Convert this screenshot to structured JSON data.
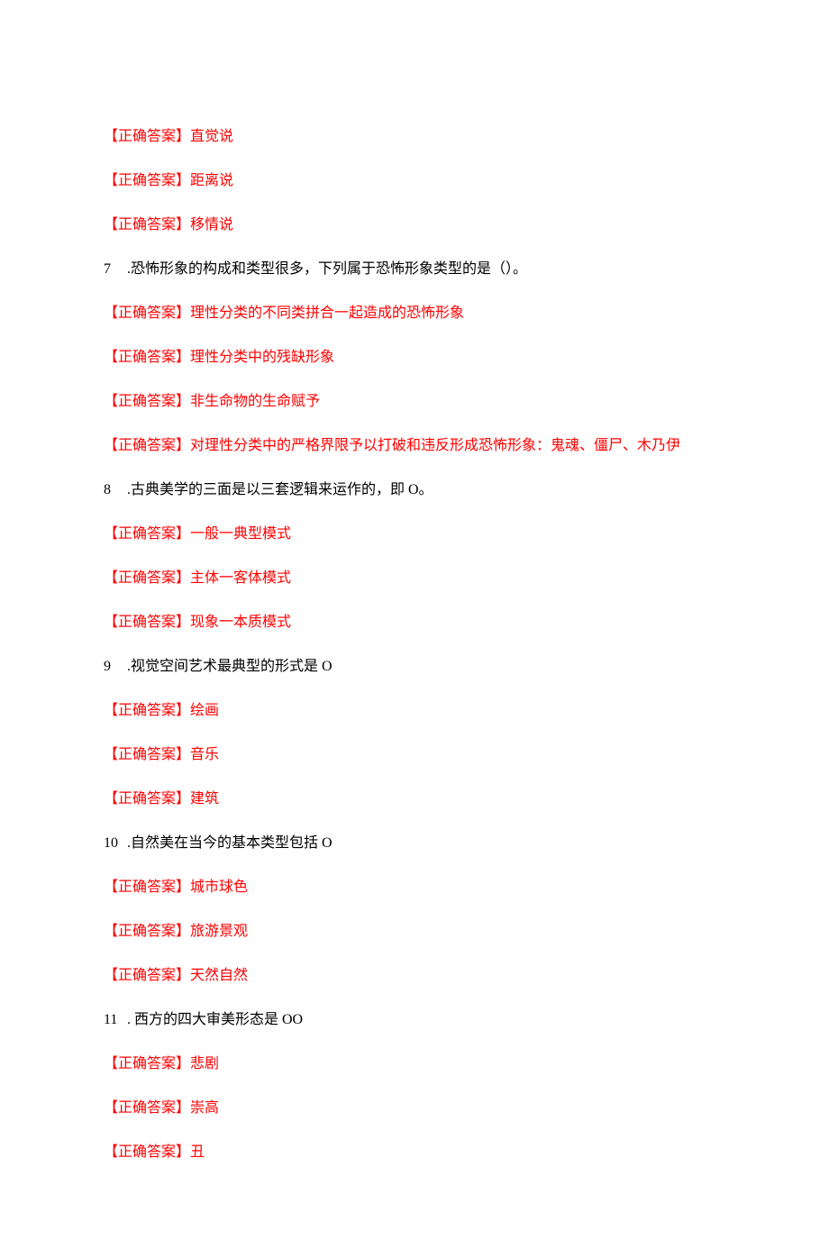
{
  "answerLabel": "【正确答案】",
  "lines": [
    {
      "type": "answer",
      "text": "直觉说"
    },
    {
      "type": "answer",
      "text": "距离说"
    },
    {
      "type": "answer",
      "text": "移情说"
    },
    {
      "type": "question",
      "num": "7",
      "text": ".恐怖形象的构成和类型很多，下列属于恐怖形象类型的是（）。"
    },
    {
      "type": "answer",
      "text": "理性分类的不同类拼合一起造成的恐怖形象"
    },
    {
      "type": "answer",
      "text": "理性分类中的残缺形象"
    },
    {
      "type": "answer",
      "text": "非生命物的生命赋予"
    },
    {
      "type": "answer",
      "text": "对理性分类中的严格界限予以打破和违反形成恐怖形象：鬼魂、僵尸、木乃伊"
    },
    {
      "type": "question",
      "num": "8",
      "text": ".古典美学的三面是以三套逻辑来运作的，即 O。"
    },
    {
      "type": "answer",
      "text": "一般一典型模式"
    },
    {
      "type": "answer",
      "text": "主体一客体模式"
    },
    {
      "type": "answer",
      "text": "现象一本质模式"
    },
    {
      "type": "question",
      "num": "9",
      "text": ".视觉空间艺术最典型的形式是 O"
    },
    {
      "type": "answer",
      "text": "绘画"
    },
    {
      "type": "answer",
      "text": "音乐"
    },
    {
      "type": "answer",
      "text": "建筑"
    },
    {
      "type": "question",
      "num": "10",
      "text": ".自然美在当今的基本类型包括 O"
    },
    {
      "type": "answer",
      "text": "城市球色"
    },
    {
      "type": "answer",
      "text": "旅游景观"
    },
    {
      "type": "answer",
      "text": "天然自然"
    },
    {
      "type": "question",
      "num": "11",
      "text": ". 西方的四大审美形态是 OO"
    },
    {
      "type": "answer",
      "text": "悲剧"
    },
    {
      "type": "answer",
      "text": "崇高"
    },
    {
      "type": "answer",
      "text": "丑"
    }
  ]
}
